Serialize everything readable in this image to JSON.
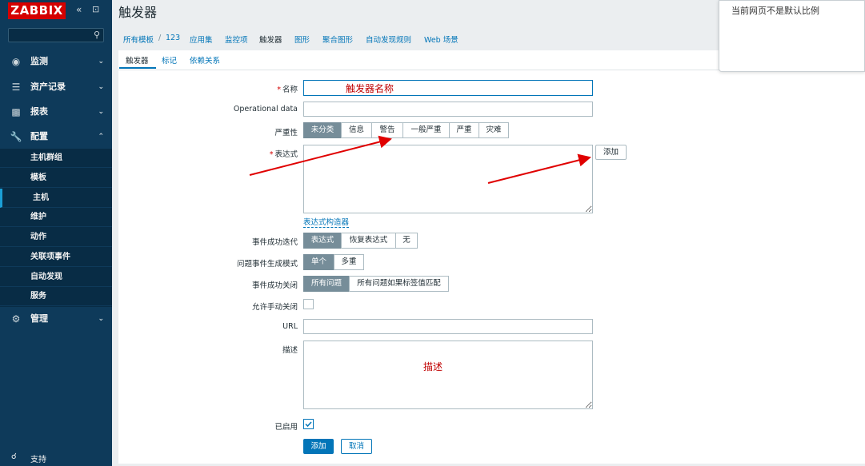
{
  "sidebar": {
    "logo": "ZABBIX",
    "collapse_icon": "«",
    "expand_icon": "⊡",
    "menu": [
      {
        "label": "监测",
        "icon": "eye-icon"
      },
      {
        "label": "资产记录",
        "icon": "list-icon"
      },
      {
        "label": "报表",
        "icon": "bar-chart-icon"
      },
      {
        "label": "配置",
        "icon": "wrench-icon"
      },
      {
        "label": "管理",
        "icon": "gear-icon"
      }
    ],
    "submenu": [
      "主机群组",
      "模板",
      "主机",
      "维护",
      "动作",
      "关联项事件",
      "自动发现",
      "服务"
    ],
    "support": "支持"
  },
  "page": {
    "title": "触发器"
  },
  "breadcrumb": {
    "all_templates": "所有模板",
    "sep": "/",
    "template": "123",
    "items": [
      "应用集",
      "监控项",
      "触发器",
      "图形",
      "聚合图形",
      "自动发现规则",
      "Web 场景"
    ]
  },
  "tabs": [
    "触发器",
    "标记",
    "依赖关系"
  ],
  "form": {
    "name_label": "名称",
    "name_value": "",
    "name_annotation": "触发器名称",
    "opdata_label": "Operational data",
    "severity_label": "严重性",
    "severity_options": [
      "未分类",
      "信息",
      "警告",
      "一般严重",
      "严重",
      "灾难"
    ],
    "expression_label": "表达式",
    "add_expression_button": "添加",
    "expression_builder_link": "表达式构造器",
    "ok_event_label": "事件成功迭代",
    "ok_event_options": [
      "表达式",
      "恢复表达式",
      "无"
    ],
    "problem_mode_label": "问题事件生成模式",
    "problem_mode_options": [
      "单个",
      "多重"
    ],
    "ok_close_label": "事件成功关闭",
    "ok_close_options": [
      "所有问题",
      "所有问题如果标签值匹配"
    ],
    "manual_close_label": "允许手动关闭",
    "url_label": "URL",
    "description_label": "描述",
    "description_annotation": "描述",
    "enabled_label": "已启用",
    "submit_button": "添加",
    "cancel_button": "取消"
  },
  "notice": {
    "text": "当前网页不是默认比例"
  },
  "colors": {
    "sidebar": "#0e3a5a",
    "accent": "#0275b8",
    "logo": "#d40000",
    "annotation": "#e00000"
  }
}
